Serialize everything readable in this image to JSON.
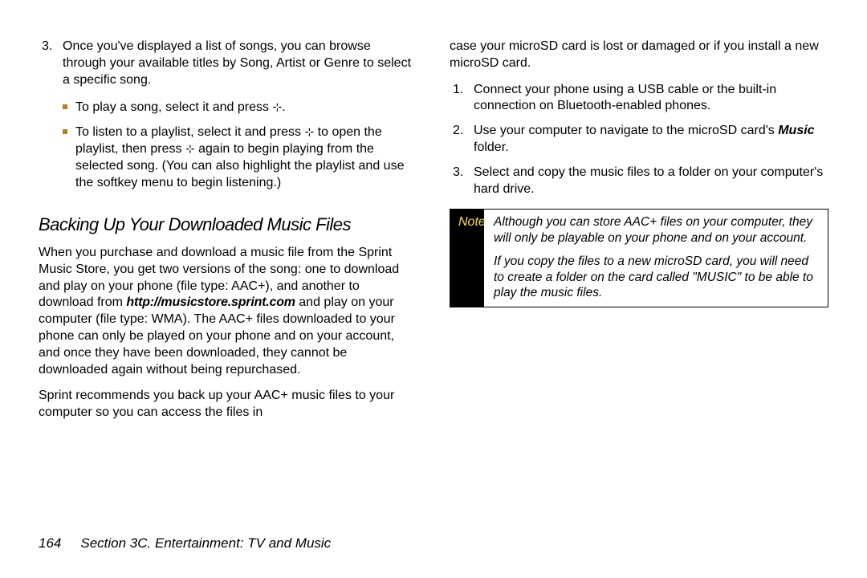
{
  "left": {
    "item3_num": "3.",
    "item3_text_a": "Once you've displayed a list of songs, you can browse through your available titles by Song, Artist or Genre to select a specific song.",
    "bullet1_a": "To play a song, select it and press ",
    "bullet1_b": ".",
    "bullet2_a": "To listen to a playlist, select it and press ",
    "bullet2_b": " to open the playlist, then press ",
    "bullet2_c": " again to begin playing from the selected song. (You can also highlight the playlist and use the softkey menu to begin listening.)",
    "section_title": "Backing Up Your Downloaded Music Files",
    "para1_a": "When you purchase and download a music file from the Sprint Music Store, you get two versions of the song: one to download and play on your phone (file type: AAC+), and another to download from ",
    "para1_url": "http://musicstore.sprint.com",
    "para1_b": " and play on your computer (file type: WMA). The AAC+ files downloaded to your phone can only be played on your phone and on your account, and once they have been downloaded, they cannot be downloaded again without being repurchased.",
    "para2": "Sprint recommends you back up your AAC+ music files to your computer so you can access the files in"
  },
  "right": {
    "cont": "case your microSD card is lost or damaged or if you install a new microSD card.",
    "r1_num": "1.",
    "r1_text": "Connect your phone using a USB cable or the built-in connection on Bluetooth-enabled phones.",
    "r2_num": "2.",
    "r2_text_a": "Use your computer to navigate to the microSD card's ",
    "r2_music": "Music",
    "r2_text_b": " folder.",
    "r3_num": "3.",
    "r3_text": "Select and copy the music files to a folder on your computer's hard drive.",
    "note_label": "Note",
    "note_p1": "Although you can store AAC+ files on your computer, they will only be playable on your phone and on your account.",
    "note_p2": "If you copy the files to a new microSD card, you will need to create a folder on the card called \"MUSIC\" to be able to play the music files."
  },
  "footer": {
    "page_num": "164",
    "section": "Section 3C. Entertainment: TV and Music"
  },
  "icons": {
    "center_key": "⊹"
  }
}
